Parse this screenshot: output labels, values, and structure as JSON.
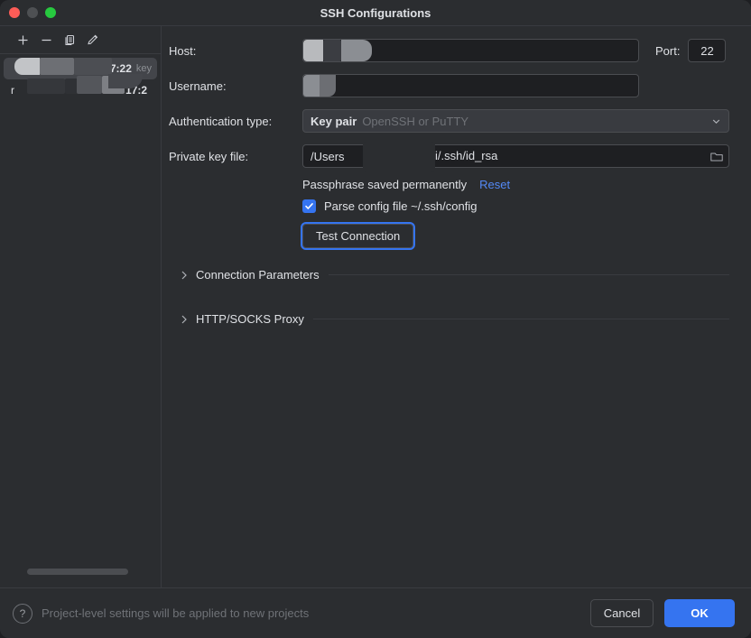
{
  "window": {
    "title": "SSH Configurations",
    "traffic_lights": [
      "close-button",
      "minimize-button",
      "maximize-button"
    ]
  },
  "sidebar": {
    "toolbar": [
      {
        "name": "add-configuration-button",
        "icon": "plus-icon"
      },
      {
        "name": "remove-configuration-button",
        "icon": "minus-icon"
      },
      {
        "name": "copy-configuration-button",
        "icon": "copy-icon"
      },
      {
        "name": "edit-configuration-button",
        "icon": "pencil-icon"
      }
    ],
    "items": [
      {
        "label": "",
        "time": "7:22",
        "tag": "key",
        "selected": true
      },
      {
        "label": "r",
        "time": "17:2",
        "tag": "",
        "selected": false
      }
    ]
  },
  "form": {
    "host_label": "Host:",
    "host_value": "",
    "port_label": "Port:",
    "port_value": "22",
    "username_label": "Username:",
    "username_value": "",
    "auth_label": "Authentication type:",
    "auth_value": "Key pair",
    "auth_hint": "OpenSSH or PuTTY",
    "key_label": "Private key file:",
    "key_value": "/Users",
    "key_value_tail": "i/.ssh/id_rsa",
    "passphrase_text": "Passphrase saved permanently",
    "reset_label": "Reset",
    "parse_config_label": "Parse config file ~/.ssh/config",
    "parse_config_checked": true,
    "test_connection_label": "Test Connection"
  },
  "sections": [
    {
      "label": "Connection Parameters",
      "expanded": false
    },
    {
      "label": "HTTP/SOCKS Proxy",
      "expanded": false
    }
  ],
  "footer": {
    "help_glyph": "?",
    "note": "Project-level settings will be applied to new projects",
    "cancel_label": "Cancel",
    "ok_label": "OK"
  },
  "colors": {
    "accent": "#3574f0",
    "link": "#548af7",
    "background": "#2b2d30",
    "field_background": "#1e1f22",
    "border": "#4b4d51",
    "text": "#dfe1e5",
    "muted_text": "#6f7277"
  }
}
